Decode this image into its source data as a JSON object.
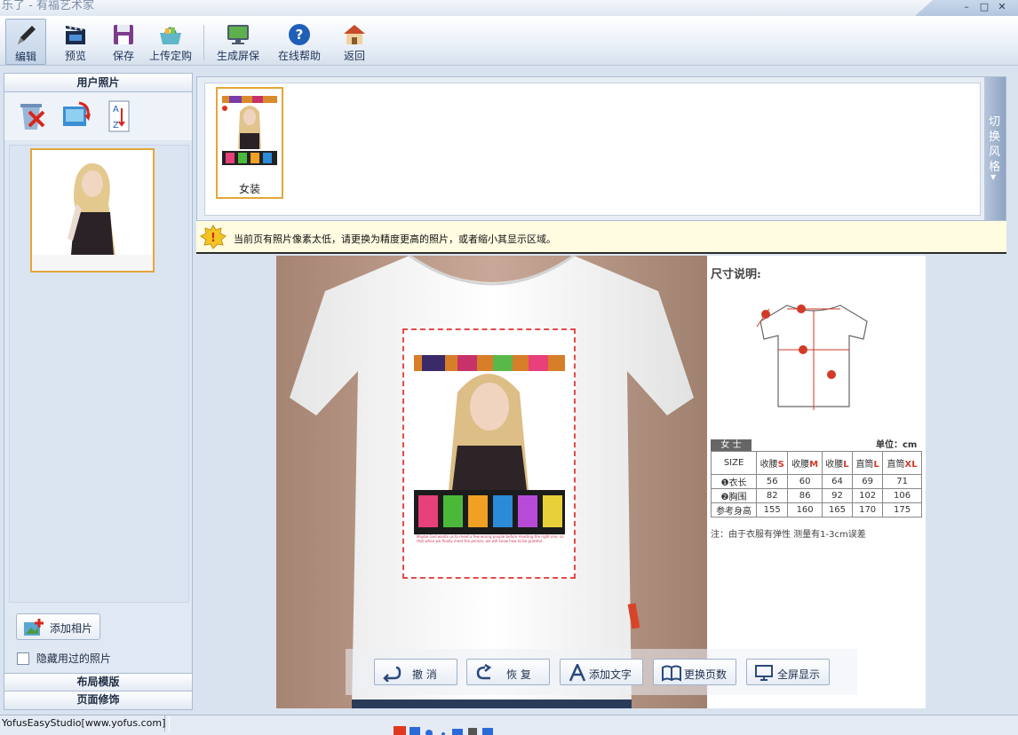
{
  "window": {
    "title": "乐了 - 有福艺术家",
    "controls": [
      "–",
      "□",
      "✕"
    ]
  },
  "toolbar": {
    "items": [
      {
        "label": "编辑",
        "icon": "pencil-icon"
      },
      {
        "label": "预览",
        "icon": "clapper-icon"
      },
      {
        "label": "保存",
        "icon": "floppy-icon"
      },
      {
        "label": "上传定购",
        "icon": "basket-icon"
      },
      {
        "label": "生成屏保",
        "icon": "monitor-icon"
      },
      {
        "label": "在线帮助",
        "icon": "help-icon"
      },
      {
        "label": "返回",
        "icon": "home-icon"
      }
    ]
  },
  "left_panel": {
    "header": "用户照片",
    "tools": [
      "recycle-delete-icon",
      "rotate-photo-icon",
      "sort-az-icon"
    ],
    "add_photo_label": "添加相片",
    "hide_used_label": "隐藏用过的照片",
    "footer_layout": "布局模版",
    "footer_decor": "页面修饰"
  },
  "style_strip": {
    "card_label": "女装",
    "switch_label": "切换风格"
  },
  "warning": {
    "message": "当前页有照片像素太低，请更换为精度更高的照片，或者缩小其显示区域。"
  },
  "size_chart": {
    "heading": "尺寸说明:",
    "tag": "女 士",
    "unit": "单位：cm",
    "header": [
      "SIZE",
      "收腰S",
      "收腰M",
      "收腰L",
      "直筒L",
      "直筒XL"
    ],
    "rows": [
      [
        "❶衣长",
        "56",
        "60",
        "64",
        "69",
        "71"
      ],
      [
        "❷胸围",
        "82",
        "86",
        "92",
        "102",
        "106"
      ],
      [
        "参考身高",
        "155",
        "160",
        "165",
        "170",
        "175"
      ]
    ],
    "note": "注：由于衣服有弹性 测量有1-3cm误差"
  },
  "print_area": {
    "caption": "Maybe God wants us to meet a few wrong people before meeting the right one, so that when we finally meet the person, we will know how to be grateful."
  },
  "bottom_toolbar": {
    "undo": "撤 消",
    "redo": "恢 复",
    "add_text": "添加文字",
    "change_page": "更换页数",
    "fullscreen": "全屏显示"
  },
  "status": {
    "left": "YofusEasyStudio[www.yofus.com]"
  },
  "colors": {
    "selection": "#e3a63a",
    "accent_red": "#d23a26",
    "panel_bg": "#dfe8f3"
  }
}
